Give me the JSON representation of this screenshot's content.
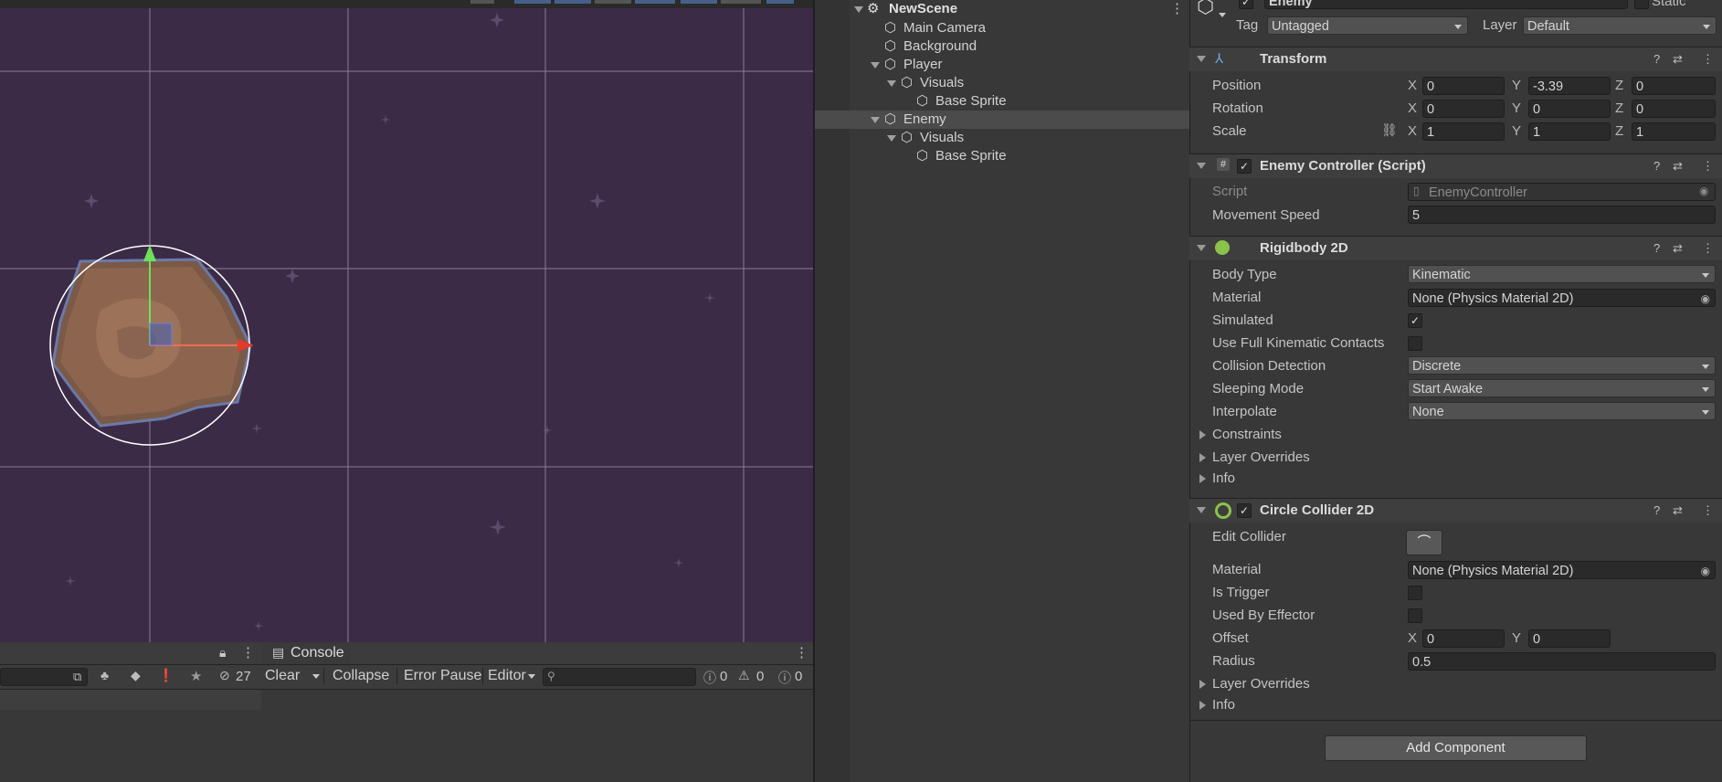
{
  "scene": {
    "grid_color": "#8a7d95",
    "background_color": "#3c2b47"
  },
  "project_panel": {
    "hidden_count": "27"
  },
  "console": {
    "tab_label": "Console",
    "clear": "Clear",
    "collapse": "Collapse",
    "error_pause": "Error Pause",
    "editor": "Editor",
    "count_info": "0",
    "count_warn": "0",
    "count_error": "0"
  },
  "hierarchy": {
    "scene_name": "NewScene",
    "items": [
      {
        "label": "Main Camera"
      },
      {
        "label": "Background"
      },
      {
        "label": "Player"
      },
      {
        "label": "Visuals"
      },
      {
        "label": "Base Sprite"
      },
      {
        "label": "Enemy"
      },
      {
        "label": "Visuals"
      },
      {
        "label": "Base Sprite"
      }
    ]
  },
  "inspector": {
    "object_name": "Enemy",
    "static_label": "Static",
    "tag_label": "Tag",
    "tag_value": "Untagged",
    "layer_label": "Layer",
    "layer_value": "Default",
    "transform": {
      "title": "Transform",
      "position_label": "Position",
      "rotation_label": "Rotation",
      "scale_label": "Scale",
      "position": {
        "x": "0",
        "y": "-3.39",
        "z": "0"
      },
      "rotation": {
        "x": "0",
        "y": "0",
        "z": "0"
      },
      "scale": {
        "x": "1",
        "y": "1",
        "z": "1"
      }
    },
    "enemy_controller": {
      "title": "Enemy Controller (Script)",
      "script_label": "Script",
      "script_value": "EnemyController",
      "speed_label": "Movement Speed",
      "speed_value": "5"
    },
    "rigidbody": {
      "title": "Rigidbody 2D",
      "body_type_label": "Body Type",
      "body_type_value": "Kinematic",
      "material_label": "Material",
      "material_value": "None (Physics Material 2D)",
      "simulated_label": "Simulated",
      "full_kinematic_label": "Use Full Kinematic Contacts",
      "collision_label": "Collision Detection",
      "collision_value": "Discrete",
      "sleeping_label": "Sleeping Mode",
      "sleeping_value": "Start Awake",
      "interpolate_label": "Interpolate",
      "interpolate_value": "None",
      "constraints_label": "Constraints",
      "layer_overrides_label": "Layer Overrides",
      "info_label": "Info"
    },
    "circle_collider": {
      "title": "Circle Collider 2D",
      "edit_collider_label": "Edit Collider",
      "material_label": "Material",
      "material_value": "None (Physics Material 2D)",
      "is_trigger_label": "Is Trigger",
      "used_by_effector_label": "Used By Effector",
      "offset_label": "Offset",
      "offset": {
        "x": "0",
        "y": "0"
      },
      "radius_label": "Radius",
      "radius_value": "0.5",
      "layer_overrides_label": "Layer Overrides",
      "info_label": "Info"
    },
    "add_component": "Add Component"
  }
}
